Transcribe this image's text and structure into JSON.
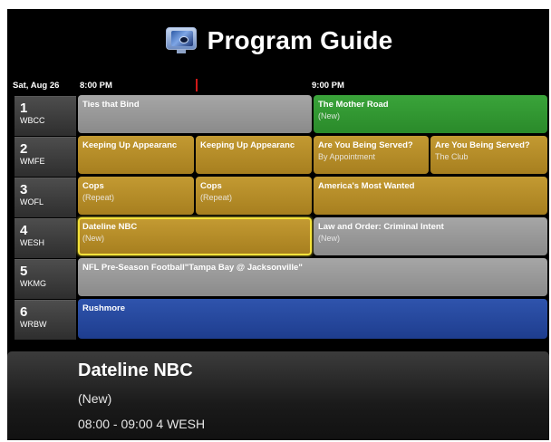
{
  "header": {
    "title": "Program Guide"
  },
  "timebar": {
    "date": "Sat, Aug 26",
    "times": [
      "8:00 PM",
      "9:00 PM"
    ]
  },
  "channels": [
    {
      "number": "1",
      "call": "WBCC"
    },
    {
      "number": "2",
      "call": "WMFE"
    },
    {
      "number": "3",
      "call": "WOFL"
    },
    {
      "number": "4",
      "call": "WESH"
    },
    {
      "number": "5",
      "call": "WKMG"
    },
    {
      "number": "6",
      "call": "WRBW"
    }
  ],
  "programs": {
    "ch1": [
      {
        "title": "Ties that Bind",
        "sub": ""
      },
      {
        "title": "The Mother Road",
        "sub": "(New)"
      }
    ],
    "ch2": [
      {
        "title": "Keeping Up Appearanc",
        "sub": ""
      },
      {
        "title": "Keeping Up Appearanc",
        "sub": ""
      },
      {
        "title": "Are You Being Served?",
        "sub": "By Appointment"
      },
      {
        "title": "Are You Being Served?",
        "sub": "The Club"
      }
    ],
    "ch3": [
      {
        "title": "Cops",
        "sub": "(Repeat)"
      },
      {
        "title": "Cops",
        "sub": "(Repeat)"
      },
      {
        "title": "America's Most Wanted",
        "sub": ""
      }
    ],
    "ch4": [
      {
        "title": "Dateline NBC",
        "sub": "(New)"
      },
      {
        "title": "Law and Order: Criminal Intent",
        "sub": "(New)"
      }
    ],
    "ch5": [
      {
        "title": "NFL Pre-Season Football\"Tampa Bay @ Jacksonville\"",
        "sub": ""
      }
    ],
    "ch6": [
      {
        "title": "Rushmore",
        "sub": ""
      }
    ]
  },
  "details": {
    "title": "Dateline NBC",
    "subtitle": "(New)",
    "time_channel": "08:00 - 09:00  4 WESH"
  },
  "colors": {
    "gray": "#9a9a9a",
    "green": "#2f9a2f",
    "gold": "#b58c28",
    "blue": "#26479c",
    "selection": "#f4e23a",
    "now_marker": "#d01818"
  },
  "icons": {
    "header": "tv-eye-icon"
  }
}
